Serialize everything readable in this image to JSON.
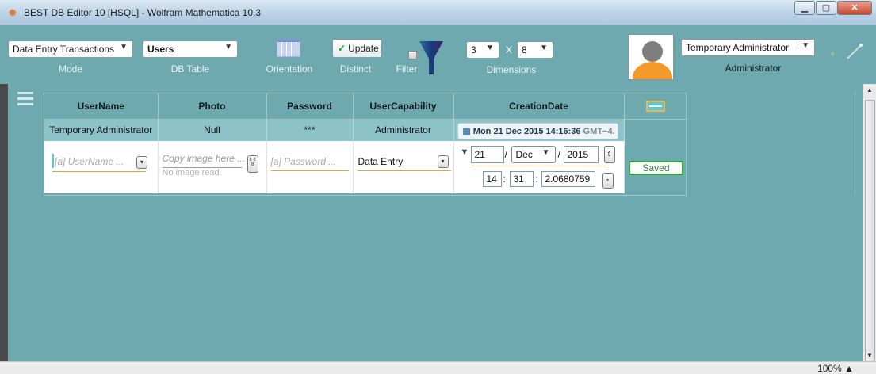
{
  "window": {
    "title": "BEST DB Editor 10 [HSQL] - Wolfram Mathematica 10.3",
    "app_icon": "gear-icon"
  },
  "toolbar": {
    "mode": {
      "value": "Data Entry Transactions",
      "caption": "Mode"
    },
    "db_table": {
      "value": "Users",
      "caption": "DB Table"
    },
    "orientation": {
      "caption": "Orientation"
    },
    "distinct": {
      "button_label": "Update",
      "caption": "Distinct"
    },
    "filter": {
      "caption": "Filter"
    },
    "dimensions": {
      "rows": "3",
      "separator": "X",
      "cols": "8",
      "caption": "Dimensions"
    },
    "user": {
      "name": "Temporary Administrator",
      "role": "Administrator"
    }
  },
  "grid": {
    "columns": [
      "UserName",
      "Photo",
      "Password",
      "UserCapability",
      "CreationDate"
    ],
    "row1": {
      "username": "Temporary Administrator",
      "photo": "Null",
      "password": "***",
      "capability": "Administrator",
      "creation_date": "Mon 21 Dec 2015 14:16:36",
      "creation_tz": "GMT−4."
    },
    "entry": {
      "username_placeholder": "[a] UserName ...",
      "photo_placeholder": "Copy image here ...",
      "photo_status": "No image read.",
      "photo_button": "8 8 8",
      "password_placeholder": "[a] Password ...",
      "capability": "Data Entry",
      "day": "21",
      "month": "Dec",
      "year": "2015",
      "hour": "14",
      "minute": "31",
      "second": "2.0680759",
      "date_sep": "/",
      "time_sep": ":"
    },
    "status": "Saved"
  },
  "statusbar": {
    "zoom": "100%"
  },
  "colors": {
    "background": "#6fa9b0",
    "header_row": "#8cc2c8",
    "saved_border": "#32a832",
    "accent": "#e2a24a"
  }
}
